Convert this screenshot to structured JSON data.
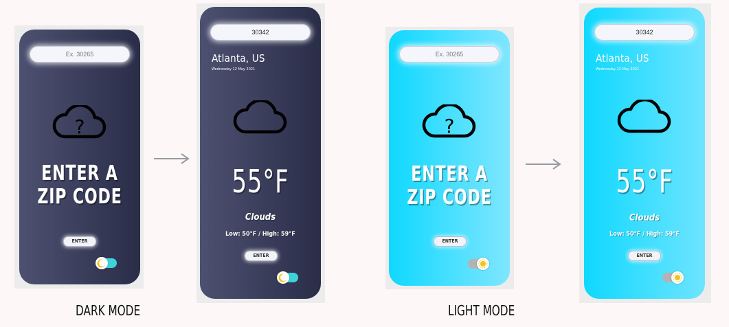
{
  "screens": {
    "dark_empty": {
      "search_placeholder": "Ex. 30265",
      "title_line1": "ENTER A",
      "title_line2": "ZIP CODE",
      "button": "ENTER",
      "theme": "moon-icon"
    },
    "dark_result": {
      "search_value": "30342",
      "city": "Atlanta, US",
      "date": "Wednesday 12 May 2021",
      "temperature": "55°F",
      "condition": "Clouds",
      "low_high": "Low: 50°F / High: 59°F",
      "button": "ENTER",
      "theme": "moon-icon"
    },
    "light_empty": {
      "search_placeholder": "Ex. 30265",
      "title_line1": "ENTER A",
      "title_line2": "ZIP CODE",
      "button": "ENTER",
      "theme": "sun-icon"
    },
    "light_result": {
      "search_value": "30342",
      "city": "Atlanta, US",
      "date": "Wednesday 12 May 2021",
      "temperature": "55°F",
      "condition": "Clouds",
      "low_high": "Low: 50°F / High: 59°F",
      "button": "ENTER",
      "theme": "sun-icon"
    }
  },
  "captions": {
    "dark": "DARK MODE",
    "light": "LIGHT MODE"
  },
  "colors": {
    "dark_gradient_start": "#4d5170",
    "dark_gradient_end": "#2a2d48",
    "light_gradient_start": "#0fd8ff",
    "light_gradient_end": "#7fe6ff",
    "toggle_on": "#3ed3da",
    "toggle_off": "#b3b3b3",
    "sun": "#f6c21a",
    "moon": "#f6c21a"
  }
}
